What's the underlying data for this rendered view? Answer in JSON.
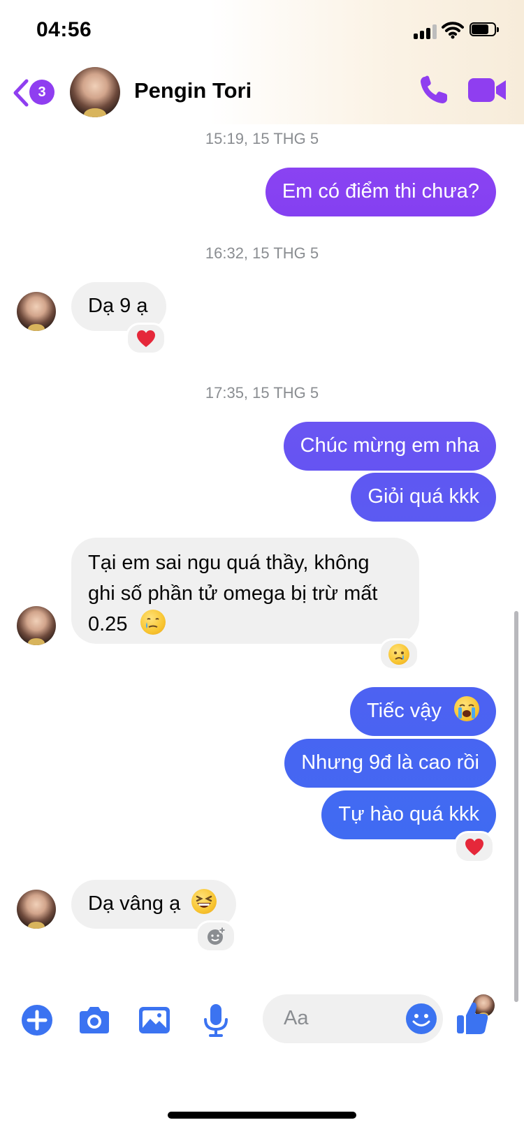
{
  "status_bar": {
    "time": "04:56"
  },
  "header": {
    "back_badge": "3",
    "contact_name": "Pengin Tori",
    "accent_color": "#8f3ef0"
  },
  "messages": [
    {
      "type": "timestamp",
      "text": "15:19, 15 THG 5"
    },
    {
      "type": "outgoing",
      "text": "Em có điểm thi chưa?"
    },
    {
      "type": "timestamp",
      "text": "16:32, 15 THG 5"
    },
    {
      "type": "incoming",
      "text": "Dạ 9 ạ",
      "reaction": "heart"
    },
    {
      "type": "timestamp",
      "text": "17:35, 15 THG 5"
    },
    {
      "type": "outgoing",
      "text": "Chúc mừng em nha"
    },
    {
      "type": "outgoing",
      "text": "Giỏi quá kkk"
    },
    {
      "type": "incoming",
      "lines": [
        "Tại em sai ngu quá thầy, không",
        "ghi số phần tử omega bị trừ mất",
        "0.25"
      ],
      "emoji": "tear-smile",
      "reaction": "crying-face"
    },
    {
      "type": "outgoing",
      "text": "Tiếc vậy",
      "emoji": "loudly-crying-face"
    },
    {
      "type": "outgoing",
      "text": "Nhưng 9đ là cao rồi"
    },
    {
      "type": "outgoing",
      "text": "Tự hào quá kkk",
      "reaction": "heart"
    },
    {
      "type": "incoming",
      "text": "Dạ vâng ạ",
      "emoji": "grinning-squinting-face",
      "reaction": "add-reaction"
    }
  ],
  "composer": {
    "placeholder": "Aa",
    "icons": [
      "plus-circle-icon",
      "camera-icon",
      "image-icon",
      "microphone-icon",
      "emoji-icon",
      "thumbs-up-icon"
    ]
  },
  "colors": {
    "outgoing_gradient_top": "#8b44f2",
    "outgoing_gradient_bottom": "#4a62f1",
    "composer_icon": "#3b73f1",
    "incoming_bubble": "#f0f0f0"
  }
}
